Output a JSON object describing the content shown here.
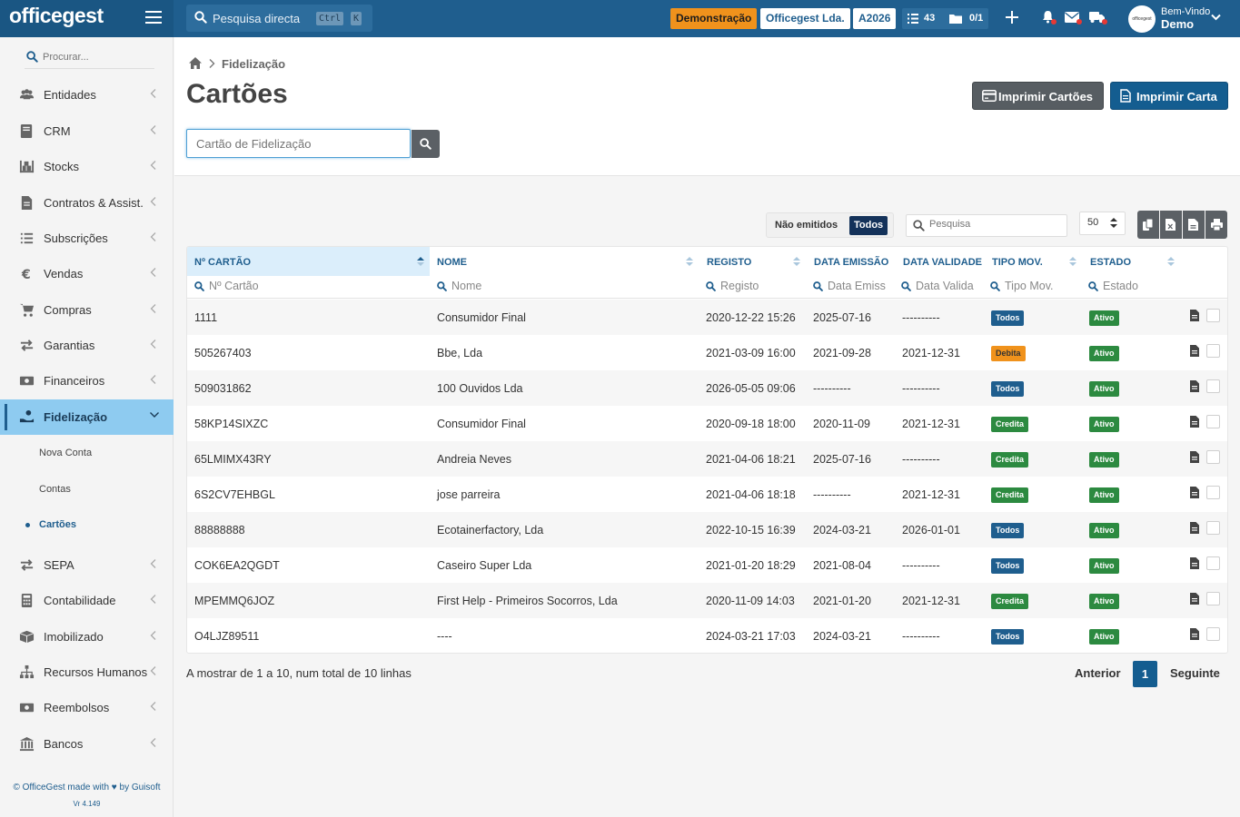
{
  "brand": {
    "logo": "officegest"
  },
  "topbar": {
    "search_placeholder": "Pesquisa directa",
    "kbd_ctrl": "Ctrl",
    "kbd_k": "K",
    "badge_demo": "Demonstração",
    "badge_company": "Officegest Lda.",
    "badge_year": "A2026",
    "counter_tasks": "43",
    "counter_docs": "0/1",
    "welcome": "Bem-Vindo",
    "user": "Demo",
    "avatar_text": "officegest"
  },
  "sidebar": {
    "search_placeholder": "Procurar...",
    "items": [
      {
        "label": "Entidades"
      },
      {
        "label": "CRM"
      },
      {
        "label": "Stocks"
      },
      {
        "label": "Contratos & Assist."
      },
      {
        "label": "Subscrições"
      },
      {
        "label": "Vendas"
      },
      {
        "label": "Compras"
      },
      {
        "label": "Garantias"
      },
      {
        "label": "Financeiros"
      },
      {
        "label": "Fidelização"
      },
      {
        "label": "SEPA"
      },
      {
        "label": "Contabilidade"
      },
      {
        "label": "Imobilizado"
      },
      {
        "label": "Recursos Humanos"
      },
      {
        "label": "Reembolsos"
      },
      {
        "label": "Bancos"
      }
    ],
    "subitems": [
      {
        "label": "Nova Conta"
      },
      {
        "label": "Contas"
      },
      {
        "label": "Cartões"
      }
    ],
    "footer": "© OfficeGest made with ♥ by Guisoft",
    "version": "Vr 4.149"
  },
  "header": {
    "breadcrumb": "Fidelização",
    "title": "Cartões",
    "btn_print_cards": "Imprimir Cartões",
    "btn_print_letter": "Imprimir Carta",
    "card_input_placeholder": "Cartão de Fidelização"
  },
  "table": {
    "toggle_off": "Não emitidos",
    "toggle_on": "Todos",
    "search_placeholder": "Pesquisa",
    "per_page": "50",
    "columns": [
      {
        "label": "Nº CARTÃO",
        "filter": "Nº Cartão"
      },
      {
        "label": "NOME",
        "filter": "Nome"
      },
      {
        "label": "REGISTO",
        "filter": "Registo"
      },
      {
        "label": "DATA EMISSÃO",
        "filter": "Data Emiss"
      },
      {
        "label": "DATA VALIDADE",
        "filter": "Data Valida"
      },
      {
        "label": "TIPO MOV.",
        "filter": "Tipo Mov."
      },
      {
        "label": "ESTADO",
        "filter": "Estado"
      }
    ],
    "rows": [
      {
        "card": "1111",
        "name": "Consumidor Final",
        "registo": "2020-12-22 15:26",
        "emissao": "2025-07-16",
        "validade": "----------",
        "tipo": "Todos",
        "tipo_class": "todos",
        "estado": "Ativo"
      },
      {
        "card": "505267403",
        "name": "Bbe, Lda",
        "registo": "2021-03-09 16:00",
        "emissao": "2021-09-28",
        "validade": "2021-12-31",
        "tipo": "Debita",
        "tipo_class": "debita",
        "estado": "Ativo"
      },
      {
        "card": "509031862",
        "name": "100 Ouvidos Lda",
        "registo": "2026-05-05 09:06",
        "emissao": "----------",
        "validade": "----------",
        "tipo": "Todos",
        "tipo_class": "todos",
        "estado": "Ativo"
      },
      {
        "card": "58KP14SIXZC",
        "name": "Consumidor Final",
        "registo": "2020-09-18 18:00",
        "emissao": "2020-11-09",
        "validade": "2021-12-31",
        "tipo": "Credita",
        "tipo_class": "credita",
        "estado": "Ativo"
      },
      {
        "card": "65LMIMX43RY",
        "name": "Andreia Neves",
        "registo": "2021-04-06 18:21",
        "emissao": "2025-07-16",
        "validade": "----------",
        "tipo": "Credita",
        "tipo_class": "credita",
        "estado": "Ativo"
      },
      {
        "card": "6S2CV7EHBGL",
        "name": "jose parreira",
        "registo": "2021-04-06 18:18",
        "emissao": "----------",
        "validade": "2021-12-31",
        "tipo": "Credita",
        "tipo_class": "credita",
        "estado": "Ativo"
      },
      {
        "card": "88888888",
        "name": "Ecotainerfactory, Lda",
        "registo": "2022-10-15 16:39",
        "emissao": "2024-03-21",
        "validade": "2026-01-01",
        "tipo": "Todos",
        "tipo_class": "todos",
        "estado": "Ativo"
      },
      {
        "card": "COK6EA2QGDT",
        "name": "Caseiro Super Lda",
        "registo": "2021-01-20 18:29",
        "emissao": "2021-08-04",
        "validade": "----------",
        "tipo": "Todos",
        "tipo_class": "todos",
        "estado": "Ativo"
      },
      {
        "card": "MPEMMQ6JOZ",
        "name": "First Help - Primeiros Socorros, Lda",
        "registo": "2020-11-09 14:03",
        "emissao": "2021-01-20",
        "validade": "2021-12-31",
        "tipo": "Credita",
        "tipo_class": "credita",
        "estado": "Ativo"
      },
      {
        "card": "O4LJZ89511",
        "name": "----",
        "registo": "2024-03-21 17:03",
        "emissao": "2024-03-21",
        "validade": "----------",
        "tipo": "Todos",
        "tipo_class": "todos",
        "estado": "Ativo"
      }
    ]
  },
  "pagination": {
    "showing": "A mostrar de 1 a 10, num total de 10 linhas",
    "prev": "Anterior",
    "page": "1",
    "next": "Seguinte"
  }
}
